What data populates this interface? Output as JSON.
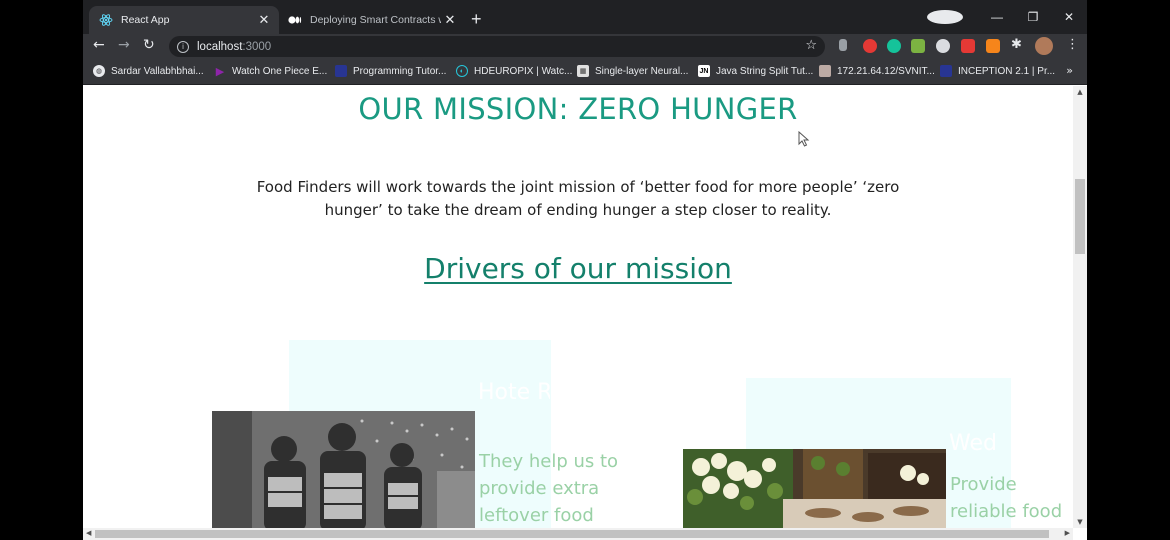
{
  "browser": {
    "tabs": [
      {
        "title": "React App",
        "icon": "react-icon"
      },
      {
        "title": "Deploying Smart Contracts with",
        "icon": "medium-icon"
      }
    ],
    "url_host": "localhost",
    "url_port": ":3000",
    "bookmarks": [
      {
        "label": "Sardar Vallabhbhai...",
        "icon": "globe-icon",
        "color": "#e8eaed"
      },
      {
        "label": "Watch One Piece E...",
        "icon": "play-icon",
        "color": "#8e24aa"
      },
      {
        "label": "Programming Tutor...",
        "icon": "site-icon",
        "color": "#3949ab"
      },
      {
        "label": "HDEUROPIX | Watc...",
        "icon": "hd-icon",
        "color": "#26c6da"
      },
      {
        "label": "Single-layer Neural...",
        "icon": "site-icon",
        "color": "#9e9e9e"
      },
      {
        "label": "Java String Split Tut...",
        "icon": "jn-icon",
        "color": "#ffffff"
      },
      {
        "label": "172.21.64.12/SVNIT...",
        "icon": "site-icon",
        "color": "#bcaaa4"
      },
      {
        "label": "INCEPTION 2.1 | Pr...",
        "icon": "site-icon",
        "color": "#3949ab"
      }
    ],
    "bookmarks_more": "»"
  },
  "page": {
    "mission_title": "OUR MISSION: ZERO HUNGER",
    "mission_text": "Food Finders will work towards the joint mission of ‘better food for more people’ ‘zero hunger’ to take the dream of ending hunger a step closer to reality.",
    "drivers_heading": "Drivers of our mission",
    "cards": [
      {
        "heading": "Hote Restau",
        "text": "They help us to provide extra leftover food"
      },
      {
        "heading": "Wed",
        "text": "Provide reliable food"
      }
    ]
  },
  "colors": {
    "accent": "#1a9a82",
    "card_bg": "#eefdfd",
    "card_text": "#9ad1a6"
  }
}
